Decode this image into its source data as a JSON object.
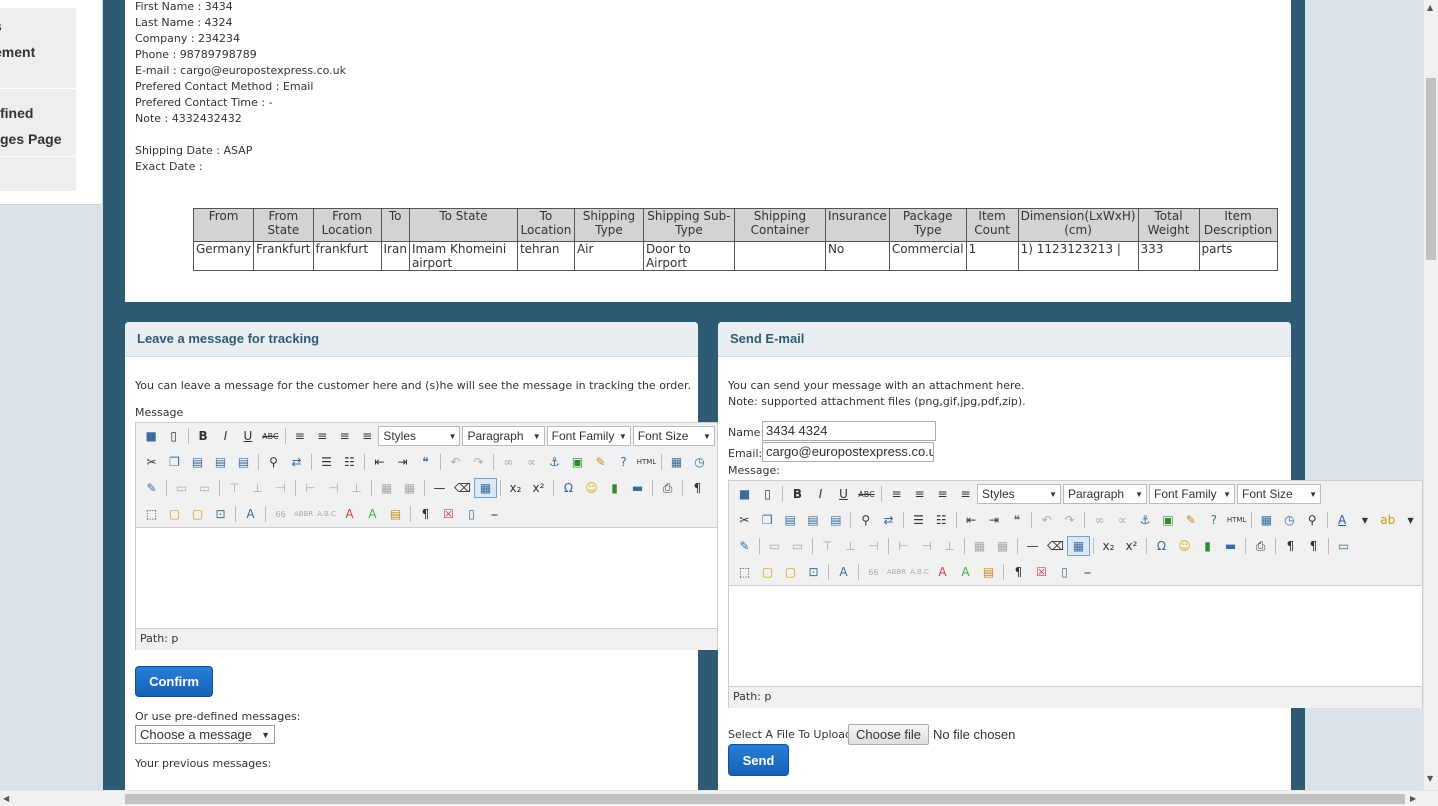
{
  "sidebar": {
    "items": [
      "s",
      "ement",
      "fined",
      "ges Page"
    ]
  },
  "order_info": {
    "lines": [
      "First Name : 3434",
      "Last Name : 4324",
      "Company : 234234",
      "Phone : 98789798789",
      "E-mail : cargo@europostexpress.co.uk",
      "Prefered Contact Method : Email",
      "Prefered Contact Time : -",
      "Note : 4332432432",
      "",
      "Shipping Date : ASAP",
      "Exact Date :"
    ]
  },
  "shipment_table": {
    "headers": [
      "From",
      "From State",
      "From Location",
      "To",
      "To State",
      "To Location",
      "Shipping Type",
      "Shipping Sub-Type",
      "Shipping Container",
      "Insurance",
      "Package Type",
      "Item Count",
      "Dimension(LxWxH) (cm)",
      "Total Weight",
      "Item Description"
    ],
    "rows": [
      [
        "Germany",
        "Frankfurt",
        "frankfurt",
        "Iran",
        "Imam Khomeini airport",
        "tehran",
        "Air",
        "Door to Airport",
        "",
        "No",
        "Commercial",
        "1",
        "1) 1123123213 |",
        "333",
        "parts"
      ]
    ]
  },
  "tracking_panel": {
    "title": "Leave a message for tracking",
    "intro": "You can leave a message for the customer here and (s)he will see the message in tracking the order.",
    "message_label": "Message",
    "editor": {
      "styles": "Styles",
      "paragraph": "Paragraph",
      "font_family": "Font Family",
      "font_size": "Font Size",
      "path": "Path: p"
    },
    "confirm_label": "Confirm",
    "predefined_label": "Or use pre-defined messages:",
    "predefined_select": "Choose a message",
    "previous_label": "Your previous messages:"
  },
  "email_panel": {
    "title": "Send E-mail",
    "intro_1": "You can send your message with an attachment here.",
    "intro_2": "Note: supported attachment files (png,gif,jpg,pdf,zip).",
    "name_label": "Name:",
    "name_value": "3434 4324",
    "email_label": "Email:",
    "email_value": "cargo@europostexpress.co.u",
    "message_label": "Message:",
    "editor": {
      "styles": "Styles",
      "paragraph": "Paragraph",
      "font_family": "Font Family",
      "font_size": "Font Size",
      "path": "Path: p"
    },
    "file_label": "Select A File To Upload:",
    "choose_file": "Choose file",
    "no_file": "No file chosen",
    "send_label": "Send"
  },
  "colors": {
    "frame": "#2e5a74",
    "panel_title": "#2e5a74",
    "button": "#1a6cc8"
  }
}
